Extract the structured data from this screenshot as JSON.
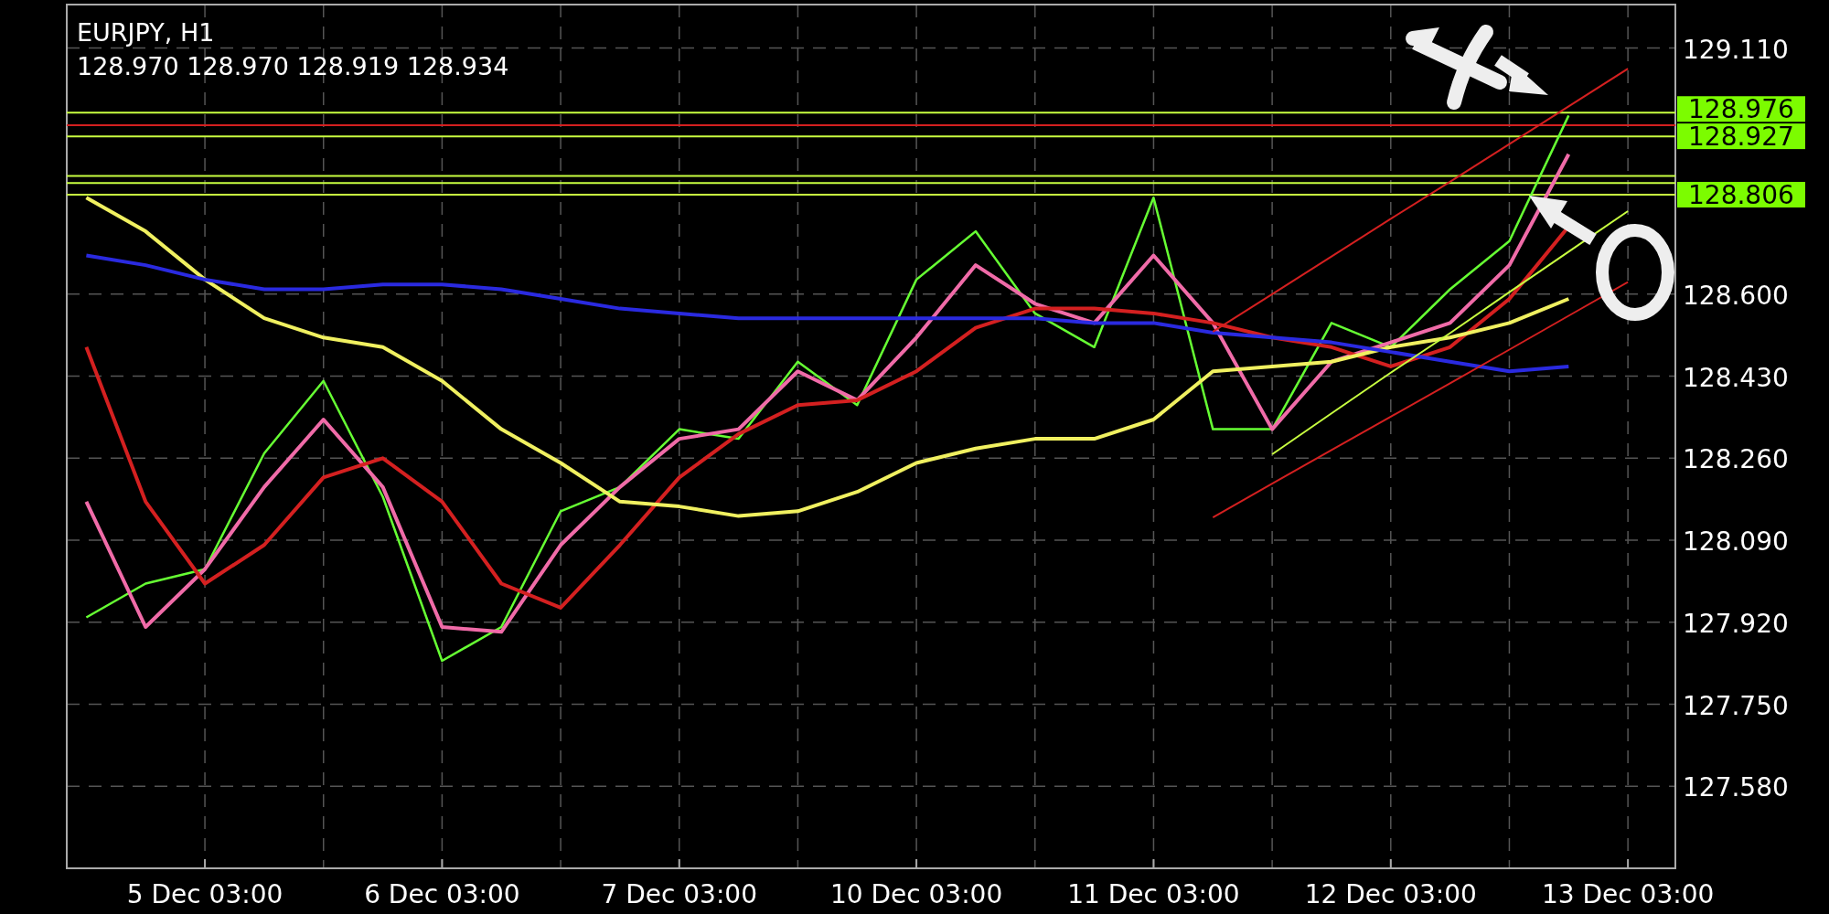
{
  "chart": {
    "symbol": "EURJPY, H1",
    "ohlc": "128.970 128.970 128.919 128.934",
    "chart_data": {
      "type": "line",
      "grid": true,
      "ylim": [
        127.41,
        129.2
      ],
      "categories": [
        null,
        null,
        "5 Dec 03:00",
        null,
        null,
        null,
        "6 Dec 03:00",
        null,
        null,
        null,
        "7 Dec 03:00",
        null,
        null,
        null,
        "10 Dec 03:00",
        null,
        null,
        null,
        "11 Dec 03:00",
        null,
        null,
        null,
        "12 Dec 03:00",
        null,
        null,
        null,
        "13 Dec 03:00",
        null
      ],
      "yticks": [
        {
          "value": 129.11,
          "label": "129.110"
        },
        {
          "value": 128.6,
          "label": "128.600"
        },
        {
          "value": 128.43,
          "label": "128.430"
        },
        {
          "value": 128.26,
          "label": "128.260"
        },
        {
          "value": 128.09,
          "label": "128.090"
        },
        {
          "value": 127.92,
          "label": "127.920"
        },
        {
          "value": 127.75,
          "label": "127.750"
        },
        {
          "value": 127.58,
          "label": "127.580"
        }
      ],
      "series": [
        {
          "color": "#66ff33",
          "values": [
            127.93,
            128.0,
            128.03,
            128.27,
            128.42,
            128.18,
            127.84,
            127.91,
            128.15,
            128.2,
            128.32,
            128.3,
            128.46,
            128.37,
            128.63,
            128.73,
            128.56,
            128.49,
            128.8,
            128.32,
            128.32,
            128.54,
            128.49,
            128.61,
            128.71,
            128.97,
            null,
            null
          ]
        },
        {
          "color": "#f06ba8",
          "values": [
            128.17,
            127.91,
            128.03,
            128.2,
            128.34,
            128.2,
            127.91,
            127.9,
            128.08,
            128.2,
            128.3,
            128.32,
            128.44,
            128.38,
            128.51,
            128.66,
            128.58,
            128.54,
            128.68,
            128.54,
            128.32,
            128.46,
            128.5,
            128.54,
            128.66,
            128.89,
            null,
            null
          ]
        },
        {
          "color": "#d42020",
          "values": [
            128.49,
            128.17,
            128.0,
            128.08,
            128.22,
            128.26,
            128.17,
            128.0,
            127.95,
            128.08,
            128.22,
            128.31,
            128.37,
            128.38,
            128.44,
            128.53,
            128.57,
            128.57,
            128.56,
            128.54,
            128.51,
            128.49,
            128.45,
            128.49,
            128.59,
            128.74,
            null,
            null
          ]
        },
        {
          "color": "#f0f060",
          "values": [
            128.8,
            128.73,
            128.63,
            128.55,
            128.51,
            128.49,
            128.42,
            128.32,
            128.25,
            128.17,
            128.16,
            128.14,
            128.15,
            128.19,
            128.25,
            128.28,
            128.3,
            128.3,
            128.34,
            128.44,
            128.45,
            128.46,
            128.49,
            128.51,
            128.54,
            128.59,
            null,
            null
          ]
        },
        {
          "color": "#2a2ae0",
          "values": [
            128.68,
            128.66,
            128.63,
            128.61,
            128.61,
            128.62,
            128.62,
            128.61,
            128.59,
            128.57,
            128.56,
            128.55,
            128.55,
            128.55,
            128.55,
            128.55,
            128.55,
            128.54,
            128.54,
            128.52,
            128.51,
            128.5,
            128.48,
            128.46,
            128.44,
            128.45,
            null,
            null
          ]
        },
        {
          "color": "#d42020",
          "values": [
            null,
            null,
            null,
            null,
            null,
            null,
            null,
            null,
            null,
            null,
            null,
            null,
            null,
            null,
            null,
            null,
            null,
            null,
            null,
            128.522,
            128.6,
            128.678,
            128.756,
            128.833,
            128.911,
            128.989,
            129.067,
            null
          ]
        },
        {
          "color": "#d42020",
          "values": [
            null,
            null,
            null,
            null,
            null,
            null,
            null,
            null,
            null,
            null,
            null,
            null,
            null,
            null,
            null,
            null,
            null,
            null,
            null,
            128.137,
            128.207,
            128.277,
            128.346,
            128.415,
            128.485,
            128.555,
            128.625,
            null
          ]
        },
        {
          "color": "#c8ff40",
          "values": [
            null,
            null,
            null,
            null,
            null,
            null,
            null,
            null,
            null,
            null,
            null,
            null,
            null,
            null,
            null,
            null,
            null,
            null,
            null,
            null,
            128.268,
            128.353,
            128.437,
            128.519,
            128.604,
            128.688,
            128.772,
            null
          ]
        }
      ],
      "ref_lines": [
        {
          "axis": "y",
          "value": 128.976,
          "color": "#c8ff40",
          "label": "128.976"
        },
        {
          "axis": "y",
          "value": 128.95,
          "color": "#d42020"
        },
        {
          "axis": "y",
          "value": 128.927,
          "color": "#c8ff40",
          "label": "128.927"
        },
        {
          "axis": "y",
          "value": 128.845,
          "color": "#c8ff40"
        },
        {
          "axis": "y",
          "value": 128.83,
          "color": "#c8ff40"
        },
        {
          "axis": "y",
          "value": 128.806,
          "color": "#c8ff40",
          "label": "128.806"
        }
      ]
    }
  }
}
